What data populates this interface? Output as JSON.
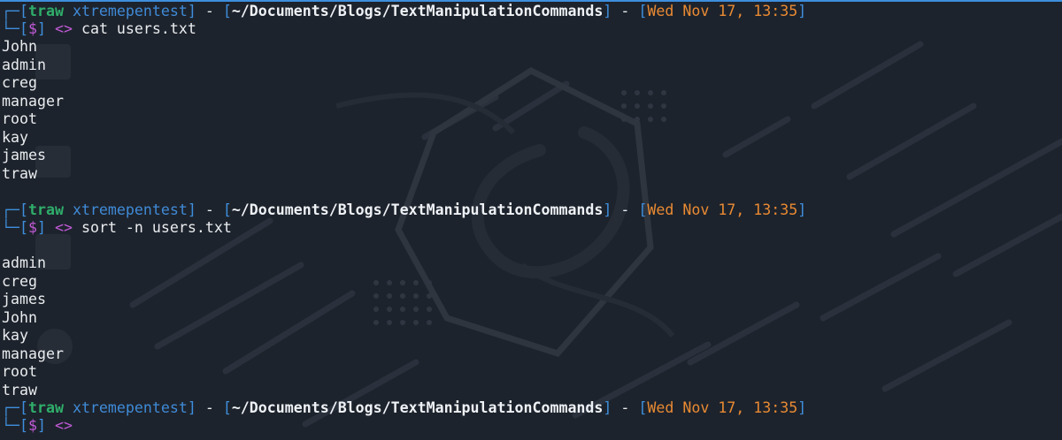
{
  "prompts": [
    {
      "user": "traw",
      "host": "xtremepentest",
      "path": "~/Documents/Blogs/TextManipulationCommands",
      "datetime": "Wed Nov 17, 13:35",
      "symbol": "$",
      "arrow": "<>",
      "command": "cat users.txt"
    },
    {
      "user": "traw",
      "host": "xtremepentest",
      "path": "~/Documents/Blogs/TextManipulationCommands",
      "datetime": "Wed Nov 17, 13:35",
      "symbol": "$",
      "arrow": "<>",
      "command": "sort -n users.txt"
    },
    {
      "user": "traw",
      "host": "xtremepentest",
      "path": "~/Documents/Blogs/TextManipulationCommands",
      "datetime": "Wed Nov 17, 13:35",
      "symbol": "$",
      "arrow": "<>",
      "command": ""
    }
  ],
  "outputs": {
    "cat": [
      "John",
      "admin",
      "creg",
      "manager",
      "root",
      "kay",
      "james",
      "traw"
    ],
    "sort": [
      "admin",
      "creg",
      "james",
      "John",
      "kay",
      "manager",
      "root",
      "traw"
    ]
  },
  "colors": {
    "background": "#1d232c",
    "frame": "#3e8edc",
    "user": "#2fae6b",
    "date": "#e98a33",
    "symbol": "#c15ad8"
  }
}
